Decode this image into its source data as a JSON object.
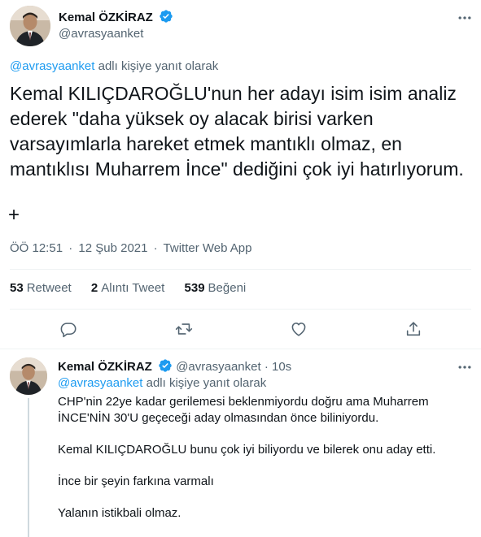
{
  "main_tweet": {
    "author_name": "Kemal ÖZKİRAZ",
    "handle": "@avrasyaanket",
    "replying_mention": "@avrasyaanket",
    "replying_suffix": " adlı kişiye yanıt olarak",
    "text": "Kemal KILIÇDAROĞLU'nun her adayı isim isim analiz ederek \"daha yüksek oy alacak birisi varken varsayımlarla hareket etmek mantıklı olmaz, en mantıklısı Muharrem İnce\" dediğini çok iyi hatırlıyorum.",
    "extra_symbol": "+",
    "time": "ÖÖ 12:51",
    "date": "12 Şub 2021",
    "source": "Twitter Web App",
    "meta_separator": "·",
    "stats": {
      "retweets_count": "53",
      "retweets_label": "Retweet",
      "quotes_count": "2",
      "quotes_label": "Alıntı Tweet",
      "likes_count": "539",
      "likes_label": "Beğeni"
    },
    "actions": [
      "reply-icon",
      "retweet-icon",
      "like-icon",
      "share-icon"
    ]
  },
  "reply_tweet": {
    "author_name": "Kemal ÖZKİRAZ",
    "handle": "@avrasyaanket",
    "separator": "·",
    "time_ago": "10s",
    "replying_mention": "@avrasyaanket",
    "replying_suffix": " adlı kişiye yanıt olarak",
    "paragraphs": [
      "CHP'nin 22ye kadar gerilemesi beklenmiyordu doğru ama Muharrem İNCE'NİN 30'U geçeceği aday olmasından önce biliniyordu.",
      "Kemal KILIÇDAROĞLU bunu çok iyi biliyordu ve bilerek onu aday etti.",
      "İnce bir şeyin farkına varmalı",
      "Yalanın istikbali olmaz."
    ]
  },
  "colors": {
    "accent": "#1d9bf0",
    "text": "#0f1419",
    "muted": "#536471",
    "border": "#eff3f4",
    "thread_line": "#cfd9de"
  }
}
